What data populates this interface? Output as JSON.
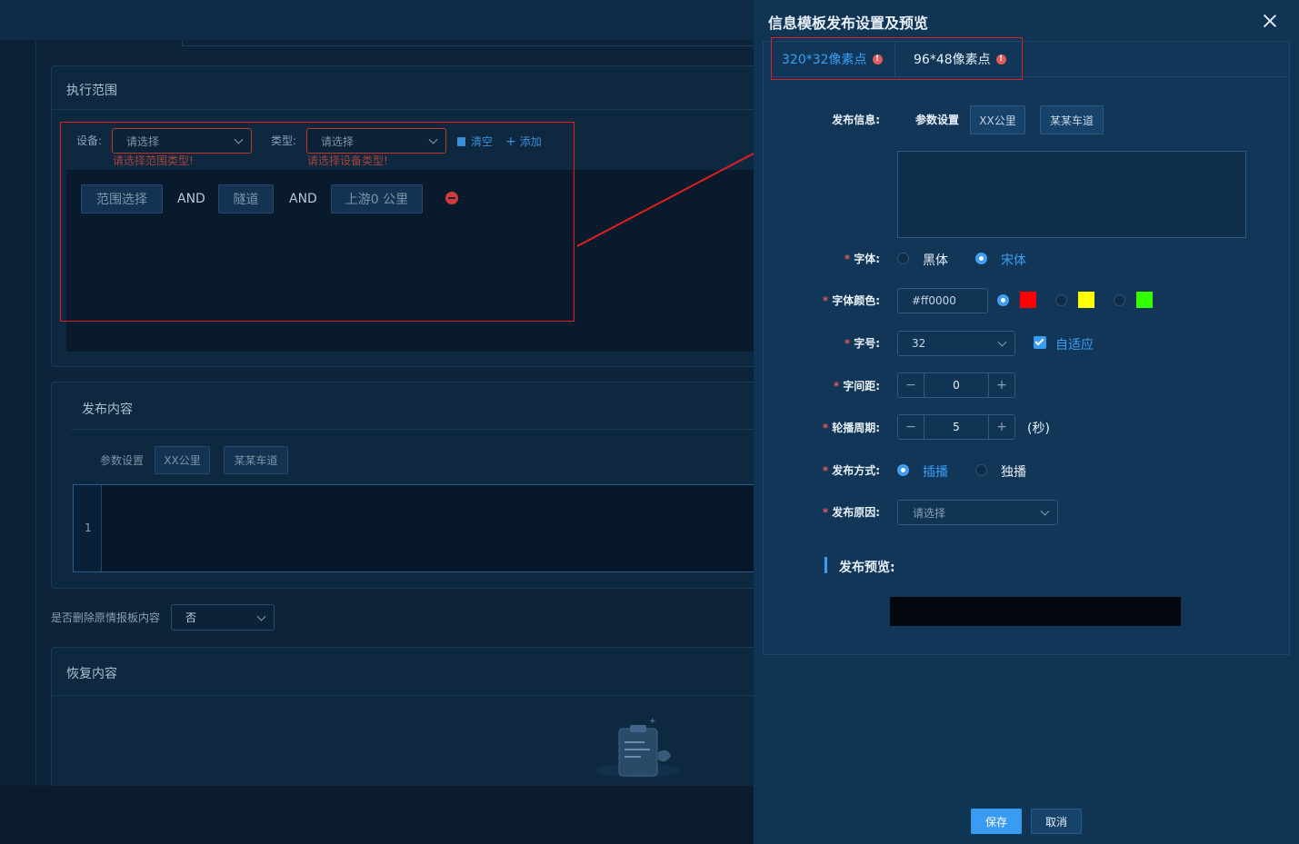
{
  "background": {
    "exec_scope": {
      "title": "执行范围",
      "device_label": "设备:",
      "device_placeholder": "请选择",
      "device_error": "请选择范围类型!",
      "type_label": "类型:",
      "type_placeholder": "请选择",
      "type_error": "请选择设备类型!",
      "clear_label": "清空",
      "add_label": "添加",
      "condition_tags": [
        "范围选择",
        "隧道",
        "上游0 公里"
      ],
      "and_1": "AND",
      "and_2": "AND"
    },
    "publish_content": {
      "title": "发布内容",
      "param_label": "参数设置",
      "chip_1": "XX公里",
      "chip_2": "某某车道",
      "line_number": "1"
    },
    "delete_original": {
      "label": "是否删除原情报板内容",
      "value": "否"
    },
    "restore_content": {
      "title": "恢复内容"
    }
  },
  "drawer": {
    "title": "信息模板发布设置及预览",
    "tabs": [
      {
        "label": "320*32像素点",
        "active": true
      },
      {
        "label": "96*48像素点",
        "active": false
      }
    ],
    "publish_info": {
      "label": "发布信息:",
      "param_label": "参数设置",
      "chip_1": "XX公里",
      "chip_2": "某某车道"
    },
    "font": {
      "label": "字体:",
      "options": [
        "黑体",
        "宋体"
      ],
      "selected": "宋体"
    },
    "font_color": {
      "label": "字体颜色:",
      "value": "#ff0000",
      "swatches": [
        "#ff0000",
        "#ffff00",
        "#33ff00"
      ],
      "selected_index": 0
    },
    "font_size": {
      "label": "字号:",
      "value": "32",
      "auto_fit_label": "自适应",
      "auto_fit_checked": true
    },
    "letter_spacing": {
      "label": "字间距:",
      "value": "0"
    },
    "carousel_period": {
      "label": "轮播周期:",
      "value": "5",
      "unit": "(秒)"
    },
    "publish_mode": {
      "label": "发布方式:",
      "options": [
        "插播",
        "独播"
      ],
      "selected": "插播"
    },
    "publish_reason": {
      "label": "发布原因:",
      "placeholder": "请选择"
    },
    "preview": {
      "label": "发布预览:"
    },
    "buttons": {
      "save": "保存",
      "cancel": "取消"
    },
    "colors": {
      "accent": "#3a9cf0",
      "required": "#e25a5a",
      "annotation": "#e02020"
    }
  }
}
